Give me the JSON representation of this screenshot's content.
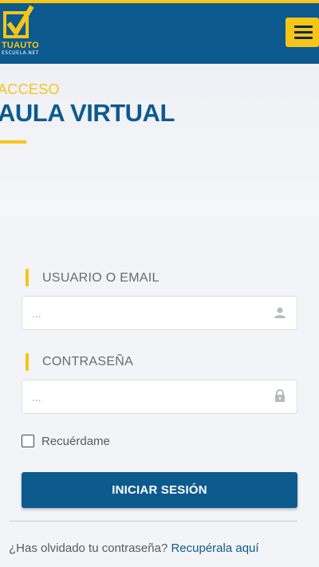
{
  "colors": {
    "brand_blue": "#0d5a8f",
    "accent_yellow": "#f5c518",
    "background": "#f3f4f8"
  },
  "header": {
    "logo_text": "TUAUTO",
    "logo_subtext": "ESCUELA.NET",
    "logo_icon": "checkbox-check-icon",
    "menu_icon": "hamburger-icon"
  },
  "hero": {
    "kicker": "ACCESO",
    "title": "AULA VIRTUAL"
  },
  "login_form": {
    "username_label": "USUARIO O EMAIL",
    "username_placeholder": "...",
    "username_icon": "user-icon",
    "password_label": "CONTRASEÑA",
    "password_placeholder": "...",
    "password_icon": "lock-icon",
    "remember_label": "Recuérdame",
    "remember_checked": false,
    "submit_label": "INICIAR SESIÓN",
    "forgot_text": "¿Has olvidado tu contraseña?",
    "forgot_link": "Recupérala aquí"
  }
}
